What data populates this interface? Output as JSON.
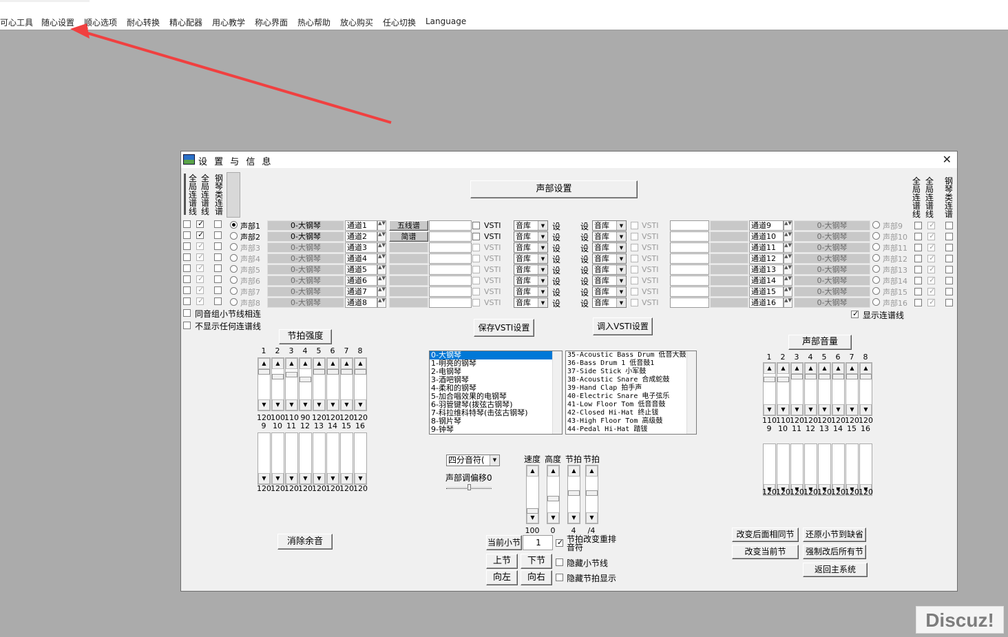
{
  "menu": [
    "可心工具",
    "随心设置",
    "顺心选项",
    "耐心转换",
    "精心配器",
    "用心教学",
    "称心界面",
    "热心帮助",
    "放心购买",
    "任心切换",
    "Language"
  ],
  "dialog": {
    "title": "设 置 与 信 息",
    "close": "✕",
    "part_settings": "声部设置",
    "save_vsti": "保存VSTI设置",
    "load_vsti": "调入VSTI设置"
  },
  "left_headers": [
    "全局连谱线",
    "全局连谱线",
    "钢琴类连谱"
  ],
  "right_headers": [
    "全局连谱线",
    "全局连谱线",
    "钢琴类连谱"
  ],
  "parts_left": [
    {
      "label": "声部1",
      "instrument": "0-大钢琴",
      "channel": "通道1",
      "c1": false,
      "c2": true,
      "c3": false,
      "active": true,
      "vsti": "VSTI",
      "lib": "音库",
      "set": "设"
    },
    {
      "label": "声部2",
      "instrument": "0-大钢琴",
      "channel": "通道2",
      "c1": false,
      "c2": true,
      "c3": false,
      "active": true,
      "vsti": "VSTI",
      "lib": "音库",
      "set": "设"
    },
    {
      "label": "声部3",
      "instrument": "0-大钢琴",
      "channel": "通道3",
      "c1": false,
      "c2": true,
      "c3": false,
      "active": false,
      "vsti": "VSTI",
      "lib": "音库",
      "set": "设"
    },
    {
      "label": "声部4",
      "instrument": "0-大钢琴",
      "channel": "通道4",
      "c1": false,
      "c2": true,
      "c3": false,
      "active": false,
      "vsti": "VSTI",
      "lib": "音库",
      "set": "设"
    },
    {
      "label": "声部5",
      "instrument": "0-大钢琴",
      "channel": "通道5",
      "c1": false,
      "c2": true,
      "c3": false,
      "active": false,
      "vsti": "VSTI",
      "lib": "音库",
      "set": "设"
    },
    {
      "label": "声部6",
      "instrument": "0-大钢琴",
      "channel": "通道6",
      "c1": false,
      "c2": true,
      "c3": false,
      "active": false,
      "vsti": "VSTI",
      "lib": "音库",
      "set": "设"
    },
    {
      "label": "声部7",
      "instrument": "0-大钢琴",
      "channel": "通道7",
      "c1": false,
      "c2": true,
      "c3": false,
      "active": false,
      "vsti": "VSTI",
      "lib": "音库",
      "set": "设"
    },
    {
      "label": "声部8",
      "instrument": "0-大钢琴",
      "channel": "通道8",
      "c1": false,
      "c2": true,
      "c3": false,
      "active": false,
      "vsti": "VSTI",
      "lib": "音库",
      "set": "设"
    }
  ],
  "parts_right": [
    {
      "label": "声部9",
      "instrument": "0-大钢琴",
      "channel": "通道9",
      "vsti": "VSTI",
      "lib": "音库",
      "set": "设"
    },
    {
      "label": "声部10",
      "instrument": "0-大钢琴",
      "channel": "通道10",
      "vsti": "VSTI",
      "lib": "音库",
      "set": "设"
    },
    {
      "label": "声部11",
      "instrument": "0-大钢琴",
      "channel": "通道11",
      "vsti": "VSTI",
      "lib": "音库",
      "set": "设"
    },
    {
      "label": "声部12",
      "instrument": "0-大钢琴",
      "channel": "通道12",
      "vsti": "VSTI",
      "lib": "音库",
      "set": "设"
    },
    {
      "label": "声部13",
      "instrument": "0-大钢琴",
      "channel": "通道13",
      "vsti": "VSTI",
      "lib": "音库",
      "set": "设"
    },
    {
      "label": "声部14",
      "instrument": "0-大钢琴",
      "channel": "通道14",
      "vsti": "VSTI",
      "lib": "音库",
      "set": "设"
    },
    {
      "label": "声部15",
      "instrument": "0-大钢琴",
      "channel": "通道15",
      "vsti": "VSTI",
      "lib": "音库",
      "set": "设"
    },
    {
      "label": "声部16",
      "instrument": "0-大钢琴",
      "channel": "通道16",
      "vsti": "VSTI",
      "lib": "音库",
      "set": "设"
    }
  ],
  "staff_buttons": [
    "五线谱",
    "简谱"
  ],
  "opts": {
    "same_group": "同音组小节线相连",
    "no_lines": "不显示任何连谱线",
    "show_lines": "显示连谱线"
  },
  "beat_strength": {
    "title": "节拍强度",
    "top_nums": [
      "1",
      "2",
      "3",
      "4",
      "5",
      "6",
      "7",
      "8"
    ],
    "top_vals": [
      "120",
      "100",
      "110",
      "90",
      "120",
      "120",
      "120",
      "120"
    ],
    "top_level": [
      1,
      0.83,
      0.92,
      0.75,
      1,
      1,
      1,
      1
    ],
    "bot_nums": [
      "9",
      "10",
      "11",
      "12",
      "13",
      "14",
      "15",
      "16"
    ],
    "bot_vals": [
      "120",
      "120",
      "120",
      "120",
      "120",
      "120",
      "120",
      "120"
    ],
    "bot_level": [
      1,
      1,
      1,
      1,
      1,
      1,
      1,
      1
    ]
  },
  "part_volume": {
    "title": "声部音量",
    "top_nums": [
      "1",
      "2",
      "3",
      "4",
      "5",
      "6",
      "7",
      "8"
    ],
    "top_vals": [
      "110",
      "110",
      "120",
      "120",
      "120",
      "120",
      "120",
      "120"
    ],
    "top_level": [
      0.92,
      0.92,
      1,
      1,
      1,
      1,
      1,
      1
    ],
    "bot_nums": [
      "9",
      "10",
      "11",
      "12",
      "13",
      "14",
      "15",
      "16"
    ],
    "bot_vals": [
      "120",
      "120",
      "120",
      "120",
      "120",
      "120",
      "120",
      "120"
    ],
    "bot_level": [
      1,
      1,
      1,
      1,
      1,
      1,
      1,
      1
    ]
  },
  "instruments": [
    "0-大钢琴",
    "1-明亮的钢琴",
    "2-电钢琴",
    "3-酒吧钢琴",
    "4-柔和的钢琴",
    "5-加合唱效果的电钢琴",
    "6-羽管键琴(拨弦古钢琴)",
    "7-科拉维科特琴(击弦古钢琴)",
    "8-钢片琴",
    "9-钟琴"
  ],
  "drums": [
    "35-Acoustic Bass Drum  低音大鼓",
    "36-Bass Drum 1 低音鼓1",
    "37-Side Stick 小军鼓",
    "38-Acoustic Snare 合成蛇鼓",
    "39-Hand Clap 拍手声",
    "40-Electric Snare 电子弦乐",
    "41-Low Floor Tom 低音音鼓",
    "42-Closed Hi-Hat 终止钹",
    "43-High Floor Tom 高级鼓",
    "44-Pedal Hi-Hat 踏钹"
  ],
  "note_combo": "四分音符(",
  "offset": "声部调偏移0",
  "tempo": {
    "labels": [
      "速度",
      "高度",
      "节拍",
      "节拍"
    ],
    "vals": [
      "100",
      "0",
      "4",
      "/4"
    ]
  },
  "nav": {
    "current": "当前小节",
    "measure": "1",
    "prev": "上节",
    "next": "下节",
    "left": "向左",
    "right": "向右",
    "beat_rearrange": "节拍改变重排音符",
    "hide_bar": "隐藏小节线",
    "hide_beat": "隐藏节拍显示"
  },
  "clear_echo": "消除余音",
  "right_buttons": [
    "改变后面相同节",
    "还原小节到缺省",
    "改变当前节",
    "强制改后所有节",
    "返回主系统"
  ],
  "watermark": "Discuz!",
  "colors": {
    "arrow": "#f04040",
    "select": "#0078d7"
  }
}
